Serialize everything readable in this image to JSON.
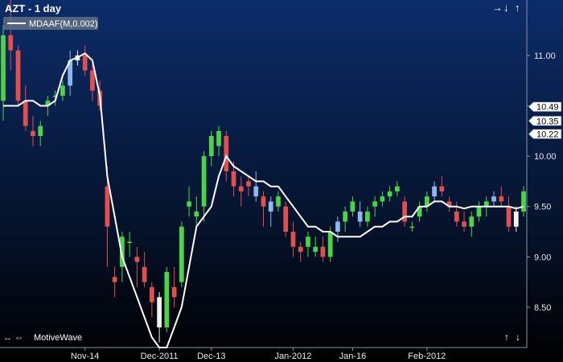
{
  "chart_title": "AZT - 1 day",
  "indicator_label": "MDAAF(M,0.002)",
  "brand_label": "MotiveWave",
  "icons": {
    "nav_top": [
      "arrow-right-icon",
      "arrow-down-icon",
      "arrow-up-icon"
    ],
    "nav_bottom_left": [
      "arrows-left-right-icon",
      "arrows-double-icon"
    ],
    "nav_bottom_right": [
      "arrow-up-icon",
      "arrow-down-icon"
    ]
  },
  "price_tags": [
    "10.49",
    "10.35",
    "10.22"
  ],
  "colors": {
    "up": "#4cd34c",
    "down": "#e0504e",
    "neutral": "#f2f2f2",
    "blue": "#8fb7ee",
    "line": "#ffffff",
    "tag_bg": "#ffffff",
    "bg_top": "#0c2c69",
    "bg_bottom": "#000000"
  },
  "chart_data": {
    "type": "candlestick",
    "title": "AZT - 1 day",
    "y_axis": {
      "ticks": [
        "11.00",
        "10.50",
        "10.00",
        "9.50",
        "9.00",
        "8.50"
      ],
      "range": [
        8.1,
        11.55
      ]
    },
    "x_axis": {
      "ticks": [
        "Nov-14",
        "Dec-2011",
        "Dec-13",
        "Jan-2012",
        "Jan-16",
        "Feb-2012"
      ]
    },
    "series": [
      {
        "name": "MDAAF(M,0.002)",
        "type": "line",
        "values": [
          10.5,
          10.5,
          10.5,
          10.55,
          10.55,
          10.5,
          10.5,
          10.55,
          10.8,
          10.95,
          10.98,
          11.02,
          10.95,
          10.6,
          9.8,
          9.4,
          9.0,
          8.8,
          8.6,
          8.4,
          8.2,
          8.1,
          8.1,
          8.3,
          8.5,
          8.9,
          9.3,
          9.4,
          9.5,
          9.8,
          10.0,
          9.9,
          9.85,
          9.8,
          9.75,
          9.75,
          9.7,
          9.7,
          9.6,
          9.5,
          9.4,
          9.3,
          9.3,
          9.25,
          9.25,
          9.2,
          9.2,
          9.2,
          9.2,
          9.25,
          9.3,
          9.3,
          9.35,
          9.35,
          9.4,
          9.4,
          9.5,
          9.5,
          9.55,
          9.55,
          9.5,
          9.5,
          9.48,
          9.5,
          9.5,
          9.5,
          9.5,
          9.5,
          9.5,
          9.48,
          9.5
        ]
      }
    ],
    "candles": [
      [
        10.55,
        11.3,
        10.35,
        11.2
      ],
      [
        11.2,
        11.55,
        10.85,
        11.05
      ],
      [
        11.05,
        11.1,
        10.5,
        10.55
      ],
      [
        10.55,
        10.7,
        10.25,
        10.3
      ],
      [
        10.25,
        10.4,
        10.1,
        10.2
      ],
      [
        10.2,
        10.35,
        10.1,
        10.3
      ],
      [
        10.5,
        10.6,
        10.4,
        10.55
      ],
      [
        10.6,
        10.65,
        10.5,
        10.6
      ],
      [
        10.6,
        10.75,
        10.55,
        10.7
      ],
      [
        10.7,
        11.05,
        10.6,
        10.95
      ],
      [
        10.95,
        11.05,
        10.9,
        11.0
      ],
      [
        11.0,
        11.1,
        10.8,
        10.85
      ],
      [
        10.85,
        10.95,
        10.55,
        10.65
      ],
      [
        10.65,
        10.75,
        10.45,
        10.5
      ],
      [
        9.7,
        9.9,
        8.9,
        9.3
      ],
      [
        8.8,
        8.9,
        8.6,
        8.75
      ],
      [
        8.9,
        9.25,
        8.75,
        9.2
      ],
      [
        9.15,
        9.25,
        9.0,
        9.15
      ],
      [
        9.0,
        9.1,
        8.7,
        8.95
      ],
      [
        8.9,
        9.05,
        8.7,
        8.75
      ],
      [
        8.7,
        8.75,
        8.4,
        8.55
      ],
      [
        8.6,
        8.65,
        8.15,
        8.3
      ],
      [
        8.3,
        8.9,
        8.25,
        8.85
      ],
      [
        8.7,
        8.9,
        8.5,
        8.6
      ],
      [
        8.75,
        9.35,
        8.7,
        9.3
      ],
      [
        9.5,
        9.7,
        9.4,
        9.55
      ],
      [
        9.4,
        9.6,
        9.3,
        9.45
      ],
      [
        9.5,
        10.05,
        9.35,
        10.0
      ],
      [
        10.0,
        10.25,
        9.9,
        10.2
      ],
      [
        10.1,
        10.3,
        10.0,
        10.25
      ],
      [
        10.2,
        10.25,
        9.75,
        9.85
      ],
      [
        9.85,
        9.95,
        9.6,
        9.7
      ],
      [
        9.7,
        9.8,
        9.5,
        9.65
      ],
      [
        9.75,
        9.8,
        9.6,
        9.7
      ],
      [
        9.7,
        9.85,
        9.55,
        9.6
      ],
      [
        9.6,
        9.65,
        9.3,
        9.5
      ],
      [
        9.45,
        9.6,
        9.3,
        9.55
      ],
      [
        9.5,
        9.65,
        9.45,
        9.6
      ],
      [
        9.5,
        9.55,
        9.2,
        9.25
      ],
      [
        9.25,
        9.35,
        9.0,
        9.1
      ],
      [
        9.1,
        9.15,
        8.95,
        9.05
      ],
      [
        9.1,
        9.25,
        9.0,
        9.2
      ],
      [
        9.05,
        9.2,
        9.0,
        9.1
      ],
      [
        9.1,
        9.2,
        8.95,
        9.0
      ],
      [
        9.0,
        9.3,
        8.95,
        9.25
      ],
      [
        9.25,
        9.4,
        9.15,
        9.35
      ],
      [
        9.35,
        9.5,
        9.25,
        9.45
      ],
      [
        9.45,
        9.6,
        9.4,
        9.55
      ],
      [
        9.45,
        9.55,
        9.3,
        9.35
      ],
      [
        9.35,
        9.5,
        9.3,
        9.45
      ],
      [
        9.5,
        9.6,
        9.4,
        9.55
      ],
      [
        9.55,
        9.65,
        9.5,
        9.6
      ],
      [
        9.6,
        9.7,
        9.55,
        9.65
      ],
      [
        9.65,
        9.75,
        9.6,
        9.7
      ],
      [
        9.55,
        9.6,
        9.3,
        9.35
      ],
      [
        9.3,
        9.35,
        9.25,
        9.3
      ],
      [
        9.4,
        9.55,
        9.35,
        9.5
      ],
      [
        9.5,
        9.65,
        9.45,
        9.6
      ],
      [
        9.6,
        9.75,
        9.55,
        9.7
      ],
      [
        9.7,
        9.8,
        9.6,
        9.65
      ],
      [
        9.55,
        9.6,
        9.45,
        9.5
      ],
      [
        9.45,
        9.55,
        9.3,
        9.35
      ],
      [
        9.35,
        9.45,
        9.25,
        9.3
      ],
      [
        9.3,
        9.45,
        9.2,
        9.4
      ],
      [
        9.4,
        9.55,
        9.35,
        9.5
      ],
      [
        9.5,
        9.6,
        9.4,
        9.55
      ],
      [
        9.55,
        9.65,
        9.5,
        9.6
      ],
      [
        9.6,
        9.7,
        9.5,
        9.55
      ],
      [
        9.5,
        9.6,
        9.25,
        9.3
      ],
      [
        9.3,
        9.5,
        9.25,
        9.45
      ],
      [
        9.45,
        9.7,
        9.4,
        9.65
      ]
    ],
    "grid": false,
    "legend": "top-left"
  }
}
